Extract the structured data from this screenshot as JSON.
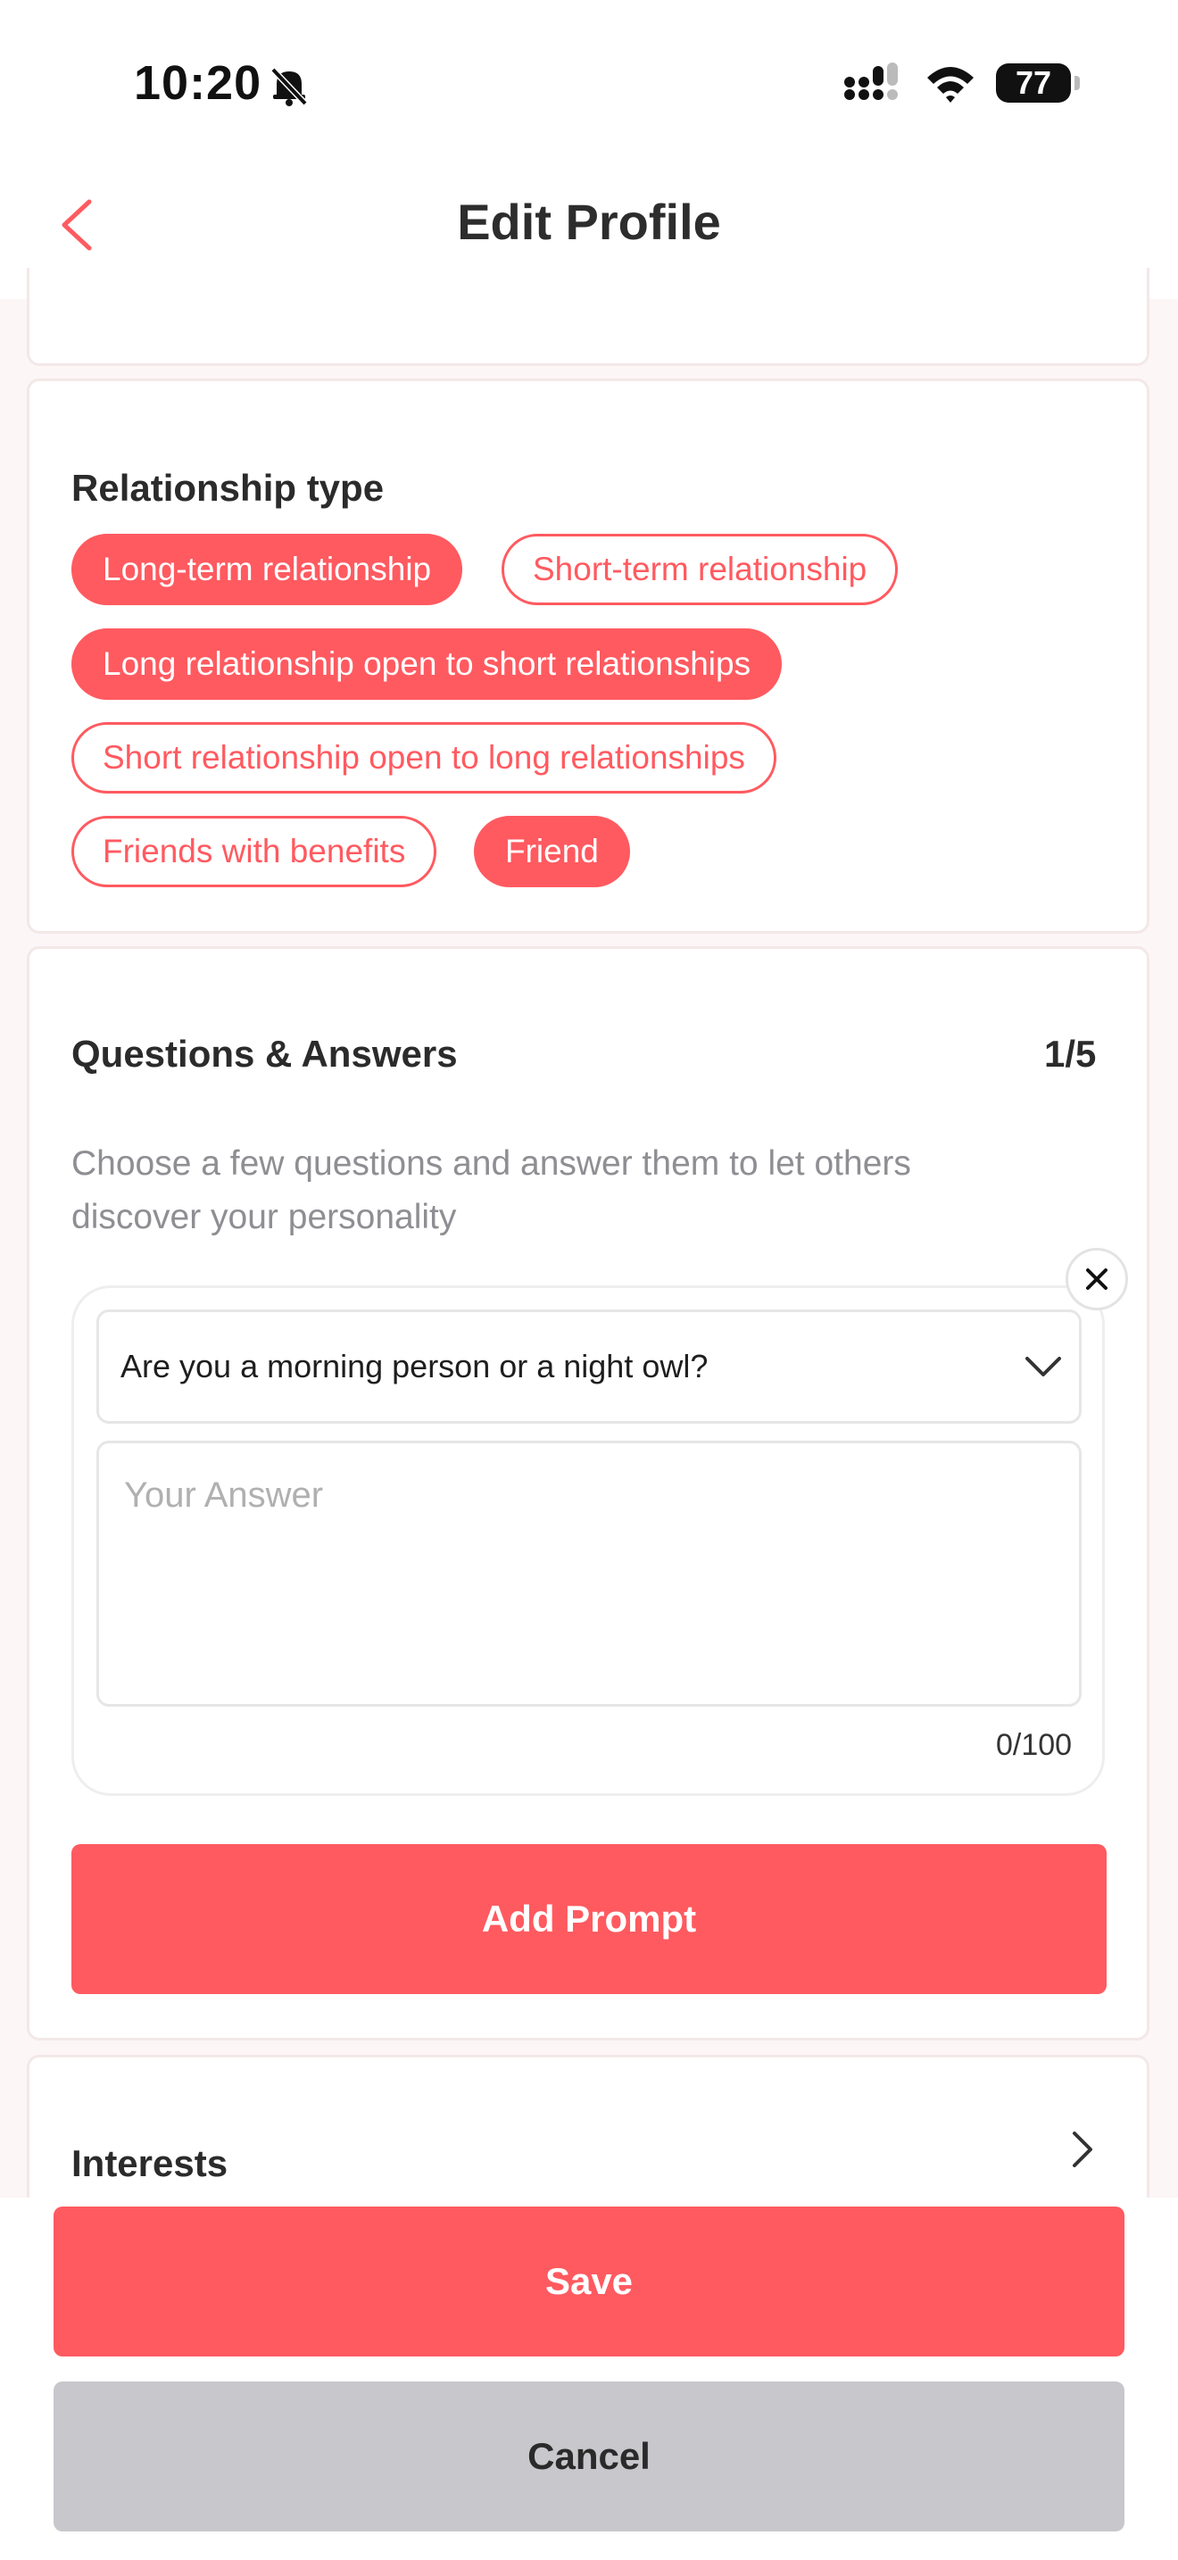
{
  "status_bar": {
    "time": "10:20",
    "battery": "77",
    "icons": [
      "bell-slash-icon",
      "signal-icon",
      "wifi-icon",
      "battery-icon"
    ]
  },
  "header": {
    "title": "Edit Profile",
    "back_icon": "chevron-left-icon"
  },
  "relationship": {
    "title": "Relationship type",
    "options": [
      {
        "label": "Long-term relationship",
        "selected": true
      },
      {
        "label": "Short-term relationship",
        "selected": false
      },
      {
        "label": "Long relationship open to short relationships",
        "selected": true
      },
      {
        "label": "Short relationship open to long relationships",
        "selected": false
      },
      {
        "label": "Friends with benefits",
        "selected": false
      },
      {
        "label": "Friend",
        "selected": true
      }
    ]
  },
  "qa": {
    "title": "Questions & Answers",
    "count": "1/5",
    "description": "Choose a few questions and answer them to let others discover your personality",
    "description_line1": "Choose a few questions and answer them to let others",
    "description_line2": "discover your personality",
    "question": "Are you a morning person or a night owl?",
    "answer_placeholder": "Your Answer",
    "counter": "0/100",
    "add_button": "Add Prompt"
  },
  "interests": {
    "title": "Interests"
  },
  "actions": {
    "save": "Save",
    "cancel": "Cancel"
  },
  "colors": {
    "accent": "#ff5a60",
    "cancel_bg": "#c7c7cc",
    "page_bg": "#fdf6f6"
  }
}
